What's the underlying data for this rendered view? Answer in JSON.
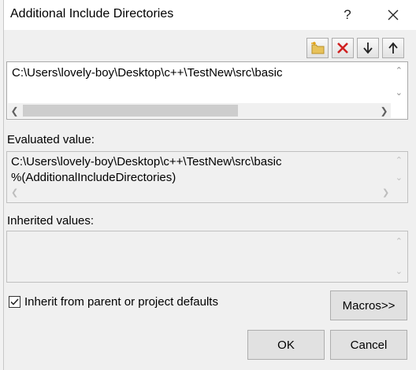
{
  "dialog": {
    "title": "Additional Include Directories",
    "help_label": "?"
  },
  "toolbar": {
    "icons": [
      "new-line-icon",
      "delete-icon",
      "move-down-icon",
      "move-up-icon"
    ]
  },
  "directories_box": {
    "lines": [
      "C:\\Users\\lovely-boy\\Desktop\\c++\\TestNew\\src\\basic"
    ]
  },
  "evaluated": {
    "label": "Evaluated value:",
    "lines": [
      "C:\\Users\\lovely-boy\\Desktop\\c++\\TestNew\\src\\basic",
      "%(AdditionalIncludeDirectories)"
    ]
  },
  "inherited": {
    "label": "Inherited values:",
    "lines": []
  },
  "inherit_checkbox": {
    "label": "Inherit from parent or project defaults",
    "checked": true
  },
  "buttons": {
    "macros": "Macros>>",
    "ok": "OK",
    "cancel": "Cancel"
  }
}
